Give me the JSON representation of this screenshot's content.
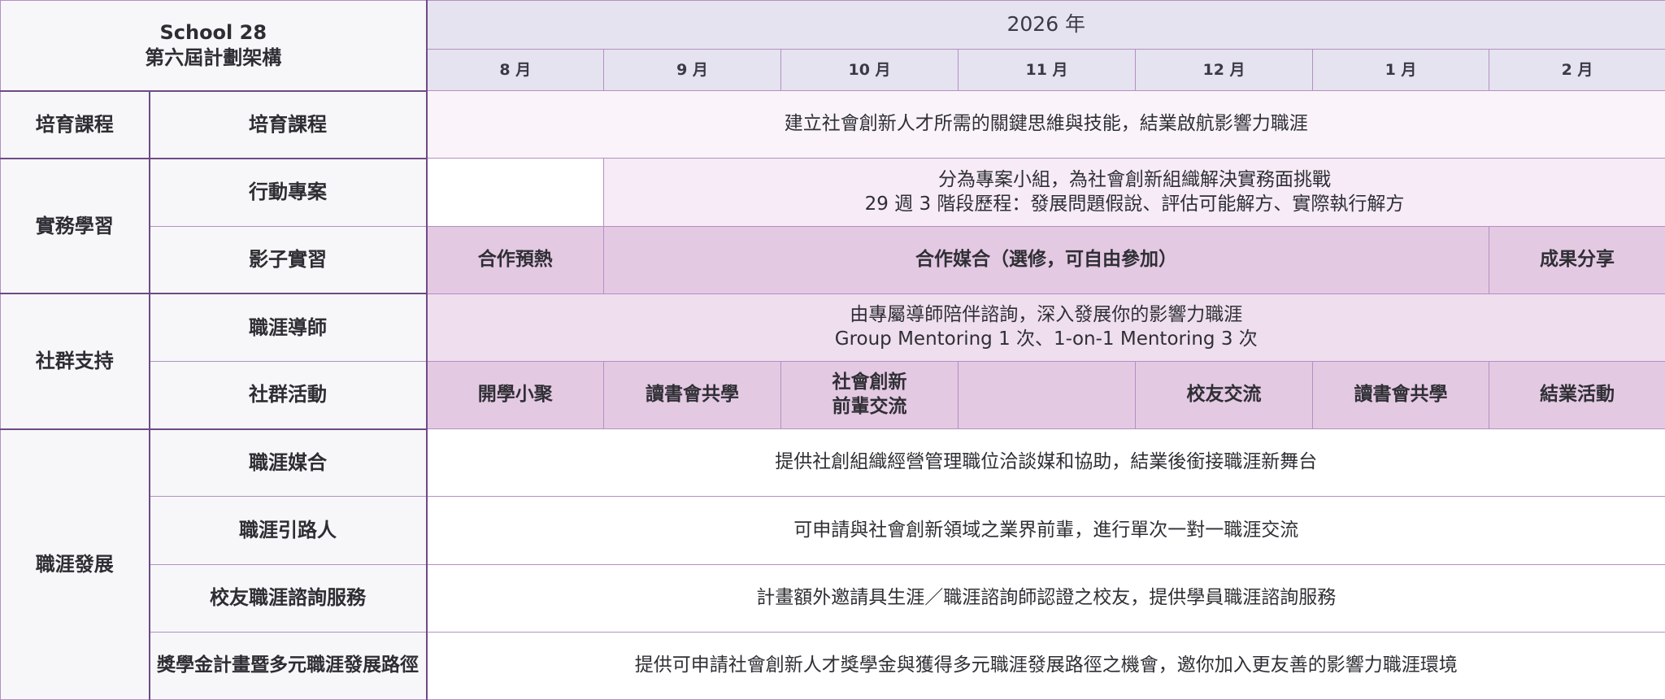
{
  "header": {
    "school": "School 28",
    "program": "第六屆計劃架構",
    "year": "2026 年",
    "months": [
      "8 月",
      "9 月",
      "10 月",
      "11 月",
      "12 月",
      "1 月",
      "2 月"
    ]
  },
  "rows": {
    "course": {
      "category": "培育課程",
      "label": "培育課程",
      "content": "建立社會創新人才所需的關鍵思維與技能，結業啟航影響力職涯"
    },
    "practice": {
      "category": "實務學習",
      "action": {
        "label": "行動專案",
        "line1": "分為專案小組，為社會創新組織解決實務面挑戰",
        "line2": "29 週 3 階段歷程：發展問題假說、評估可能解方、實際執行解方"
      },
      "shadow": {
        "label": "影子實習",
        "warmup": "合作預熱",
        "matching": "合作媒合（選修，可自由參加）",
        "share": "成果分享"
      }
    },
    "community": {
      "category": "社群支持",
      "mentor": {
        "label": "職涯導師",
        "line1": "由專屬導師陪伴諮詢，深入發展你的影響力職涯",
        "line2": "Group Mentoring 1 次、1-on-1 Mentoring 3 次"
      },
      "events": {
        "label": "社群活動",
        "aug": "開學小聚",
        "sep": "讀書會共學",
        "oct_line1": "社會創新",
        "oct_line2": "前輩交流",
        "nov": "",
        "dec": "校友交流",
        "jan": "讀書會共學",
        "feb": "結業活動"
      }
    },
    "career": {
      "category": "職涯發展",
      "matching": {
        "label": "職涯媒合",
        "content": "提供社創組織經營管理職位洽談媒和協助，結業後銜接職涯新舞台"
      },
      "guide": {
        "label": "職涯引路人",
        "content": "可申請與社會創新領域之業界前輩，進行單次一對一職涯交流"
      },
      "alumni": {
        "label": "校友職涯諮詢服務",
        "content": "計畫額外邀請具生涯／職涯諮詢師認證之校友，提供學員職涯諮詢服務"
      },
      "scholarship": {
        "label": "獎學金計畫暨多元職涯發展路徑",
        "content": "提供可申請社會創新人才獎學金與獲得多元職涯發展路徑之機會，邀你加入更友善的影響力職涯環境"
      }
    }
  }
}
